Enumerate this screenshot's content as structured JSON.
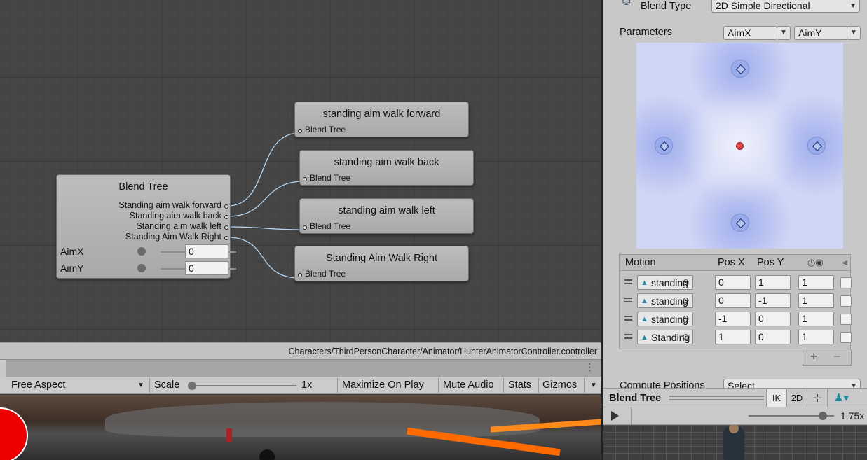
{
  "graph": {
    "blend_tree_node": {
      "title": "Blend Tree",
      "outputs": [
        "Standing aim walk forward",
        "Standing aim walk back",
        "Standing aim walk left",
        "Standing Aim Walk Right"
      ],
      "params": [
        {
          "name": "AimX",
          "value": "0"
        },
        {
          "name": "AimY",
          "value": "0"
        }
      ]
    },
    "motion_nodes": [
      {
        "title": "standing aim walk forward",
        "subtitle": "Blend Tree"
      },
      {
        "title": "standing aim walk back",
        "subtitle": "Blend Tree"
      },
      {
        "title": "standing aim walk left",
        "subtitle": "Blend Tree"
      },
      {
        "title": "Standing Aim Walk Right",
        "subtitle": "Blend Tree"
      }
    ]
  },
  "path_bar": {
    "path": "Characters/ThirdPersonCharacter/Animator/HunterAnimatorController.controller"
  },
  "game_toolbar": {
    "kebab_icon": "⋮",
    "aspect": "Free Aspect",
    "scale_label": "Scale",
    "scale_value": "1x",
    "maximize_on_play": "Maximize On Play",
    "mute_audio": "Mute Audio",
    "stats": "Stats",
    "gizmos": "Gizmos"
  },
  "inspector": {
    "blend_type_label": "Blend Type",
    "blend_type_value": "2D Simple Directional",
    "parameters_label": "Parameters",
    "param_x": "AimX",
    "param_y": "AimY",
    "blend_points": [
      {
        "x": 0,
        "y": 1
      },
      {
        "x": 0,
        "y": -1
      },
      {
        "x": -1,
        "y": 0
      },
      {
        "x": 1,
        "y": 0
      }
    ],
    "current_param": {
      "x": 0,
      "y": 0
    },
    "motion_table": {
      "headers": {
        "motion": "Motion",
        "pos_x": "Pos X",
        "pos_y": "Pos Y"
      },
      "rows": [
        {
          "name": "standing",
          "pos_x": "0",
          "pos_y": "1",
          "speed": "1"
        },
        {
          "name": "standing",
          "pos_x": "0",
          "pos_y": "-1",
          "speed": "1"
        },
        {
          "name": "standing",
          "pos_x": "-1",
          "pos_y": "0",
          "speed": "1"
        },
        {
          "name": "Standing",
          "pos_x": "1",
          "pos_y": "0",
          "speed": "1"
        }
      ],
      "add": "+",
      "remove": "−"
    },
    "compute_positions_label": "Compute Positions",
    "compute_positions_value": "Select"
  },
  "preview": {
    "title": "Blend Tree",
    "ik": "IK",
    "two_d": "2D",
    "speed_value": "1.75x"
  },
  "colors": {
    "node_gray": "#b5b5b5",
    "graph_bg": "#464646",
    "param_point": "#e04a4a",
    "blend_bg": "#d0d6f5"
  }
}
